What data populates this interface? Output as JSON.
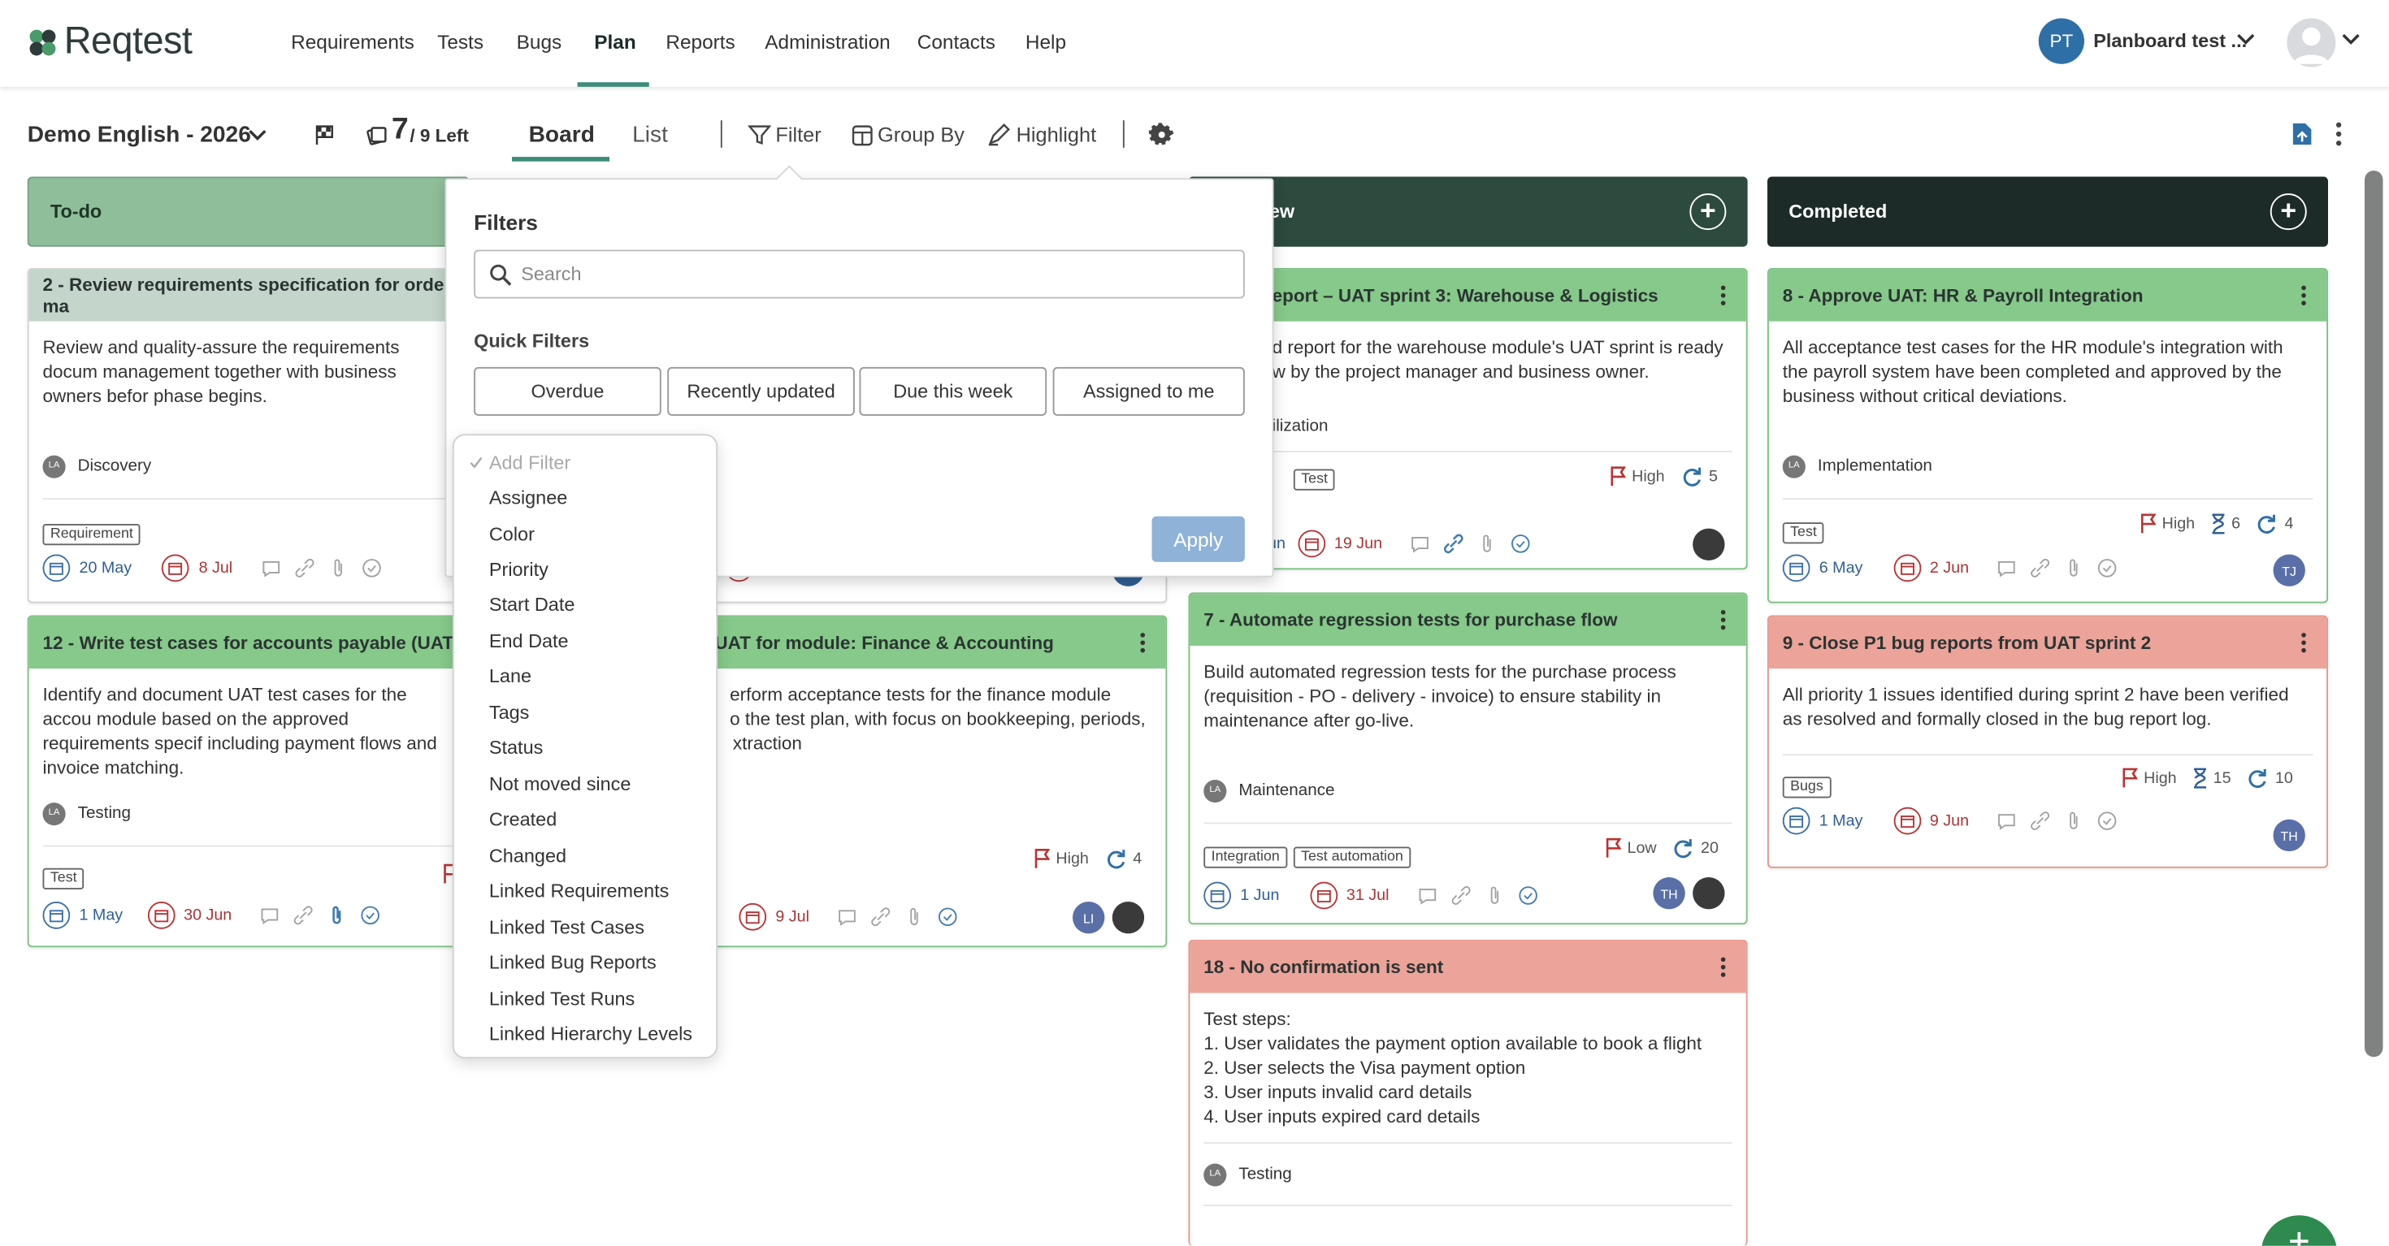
{
  "app": {
    "logo_text": "Reqtest"
  },
  "nav": {
    "items": [
      "Requirements",
      "Tests",
      "Bugs",
      "Plan",
      "Reports",
      "Administration",
      "Contacts",
      "Help"
    ],
    "active": "Plan",
    "user_initials": "PT",
    "user_name": "Planboard test ..."
  },
  "toolbar": {
    "project": "Demo English - 2026",
    "count": "7",
    "count_suffix": "/ 9 Left",
    "board": "Board",
    "list": "List",
    "filter": "Filter",
    "group_by": "Group By",
    "highlight": "Highlight"
  },
  "columns": [
    {
      "title": "To-do",
      "color": "#8fbf9a"
    },
    {
      "title": "ew",
      "color": "#2d4a3e"
    },
    {
      "title": "Completed",
      "color": "#1d2b28"
    }
  ],
  "cards": {
    "c2": {
      "title": "2 - Review requirements specification for order ma",
      "body": "Review and quality-assure the requirements docum management together with business owners befor phase begins.",
      "phase": "Discovery",
      "tags": [
        "Requirement"
      ],
      "start": "20 May",
      "end": "8 Jul"
    },
    "c12": {
      "title": "12 - Write test cases for accounts payable (UAT)",
      "body": "Identify and document UAT test cases for the accou module based on the approved requirements specif including payment flows and invoice matching.",
      "phase": "Testing",
      "tags": [
        "Test"
      ],
      "start": "1 May",
      "end": "30 Jun"
    },
    "cmid": {
      "title": "UAT for module: Finance & Accounting",
      "body_1": "erform acceptance tests for the finance module",
      "body_2": "o the test plan, with focus on bookkeeping, periods,",
      "body_3": "xtraction",
      "priority": "High",
      "count": "4",
      "end": "9 Jul",
      "avatar_1": "LI"
    },
    "cmidtop": {
      "end_day": "n"
    },
    "crep": {
      "title": "eport – UAT sprint 3: Warehouse & Logistics",
      "body_1": "d report for the warehouse module's UAT sprint is ready",
      "body_2": "w by the project manager and business owner.",
      "phase": "ilization",
      "tags": [
        "Test"
      ],
      "priority": "High",
      "count": "5",
      "start": "un",
      "end": "19 Jun"
    },
    "c7": {
      "title": "7 - Automate regression tests for purchase flow",
      "body": "Build automated regression tests for the purchase process (requisition - PO - delivery - invoice) to ensure stability in maintenance after go-live.",
      "phase": "Maintenance",
      "tags": [
        "Integration",
        "Test automation"
      ],
      "priority": "Low",
      "count": "20",
      "start": "1 Jun",
      "end": "31 Jul",
      "avatar_1": "TH"
    },
    "c18": {
      "title": "18 - No confirmation is sent",
      "body_l1": "Test steps:",
      "body_l2": "1. User validates the payment option available to book a flight",
      "body_l3": "2. User selects the Visa payment option",
      "body_l4": "3. User inputs invalid card details",
      "body_l5": "4. User inputs expired card details",
      "phase": "Testing"
    },
    "c8": {
      "title": "8 - Approve UAT: HR & Payroll Integration",
      "body": "All acceptance test cases for the HR module's integration with the payroll system have been completed and approved by the business without critical deviations.",
      "phase": "Implementation",
      "tags": [
        "Test"
      ],
      "priority": "High",
      "hourglass": "6",
      "count": "4",
      "start": "6 May",
      "end": "2 Jun",
      "avatar_1": "TJ"
    },
    "c9": {
      "title": "9 - Close P1 bug reports from UAT sprint 2",
      "body": "All priority 1 issues identified during sprint 2 have been verified as resolved and formally closed in the bug report log.",
      "tags": [
        "Bugs"
      ],
      "priority": "High",
      "hourglass": "15",
      "count": "10",
      "start": "1 May",
      "end": "9 Jun",
      "avatar_1": "TH"
    }
  },
  "filters": {
    "title": "Filters",
    "search_placeholder": "Search",
    "quick_title": "Quick Filters",
    "quick": [
      "Overdue",
      "Recently updated",
      "Due this week",
      "Assigned to me"
    ],
    "apply": "Apply",
    "add_filter": "Add Filter",
    "options": [
      "Assignee",
      "Color",
      "Priority",
      "Start Date",
      "End Date",
      "Lane",
      "Tags",
      "Status",
      "Not moved since",
      "Created",
      "Changed",
      "Linked Requirements",
      "Linked Test Cases",
      "Linked Bug Reports",
      "Linked Test Runs",
      "Linked Hierarchy Levels"
    ]
  },
  "colors": {
    "green_header": "#86c98a",
    "red_header": "#eba39a",
    "accent": "#3d8b7a"
  }
}
